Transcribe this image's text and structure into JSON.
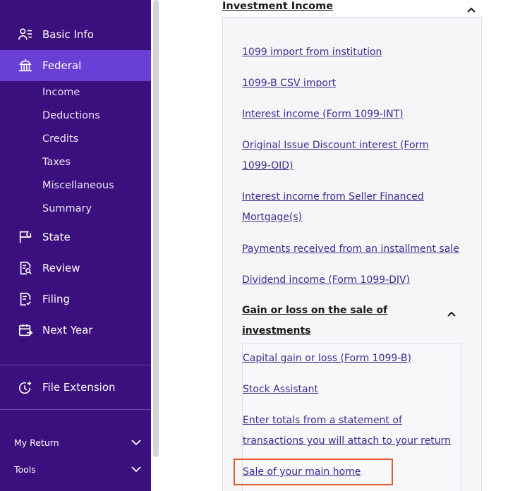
{
  "sidebar": {
    "items": [
      {
        "label": "Basic Info",
        "icon": "person-list-icon"
      },
      {
        "label": "Federal",
        "icon": "capitol-building-icon",
        "active": true
      },
      {
        "label": "State",
        "icon": "state-flag-icon"
      },
      {
        "label": "Review",
        "icon": "document-search-icon"
      },
      {
        "label": "Filing",
        "icon": "document-check-icon"
      },
      {
        "label": "Next Year",
        "icon": "calendar-arrow-icon"
      }
    ],
    "federal_sub": [
      "Income",
      "Deductions",
      "Credits",
      "Taxes",
      "Miscellaneous",
      "Summary"
    ],
    "file_extension": {
      "label": "File Extension",
      "icon": "clock-plus-icon"
    },
    "footer": [
      {
        "label": "My Return"
      },
      {
        "label": "Tools"
      }
    ],
    "colors": {
      "background": "#3b0f7d",
      "active": "#6a3fd6"
    }
  },
  "main": {
    "section_title": "Investment Income",
    "links": [
      "1099 import from institution",
      "1099-B CSV import",
      "Interest income (Form 1099-INT)",
      "Original Issue Discount interest (Form 1099-OID)",
      "Interest income from Seller Financed Mortgage(s)",
      "Payments received from an installment sale",
      "Dividend income (Form 1099-DIV)"
    ],
    "subsection": {
      "title": "Gain or loss on the sale of investments",
      "links": [
        "Capital gain or loss (Form 1099-B)",
        "Stock Assistant",
        "Enter totals from a statement of transactions you will attach to your return",
        "Sale of your main home"
      ]
    },
    "colors": {
      "link": "#3a2d91",
      "highlight": "#e0572b"
    }
  }
}
